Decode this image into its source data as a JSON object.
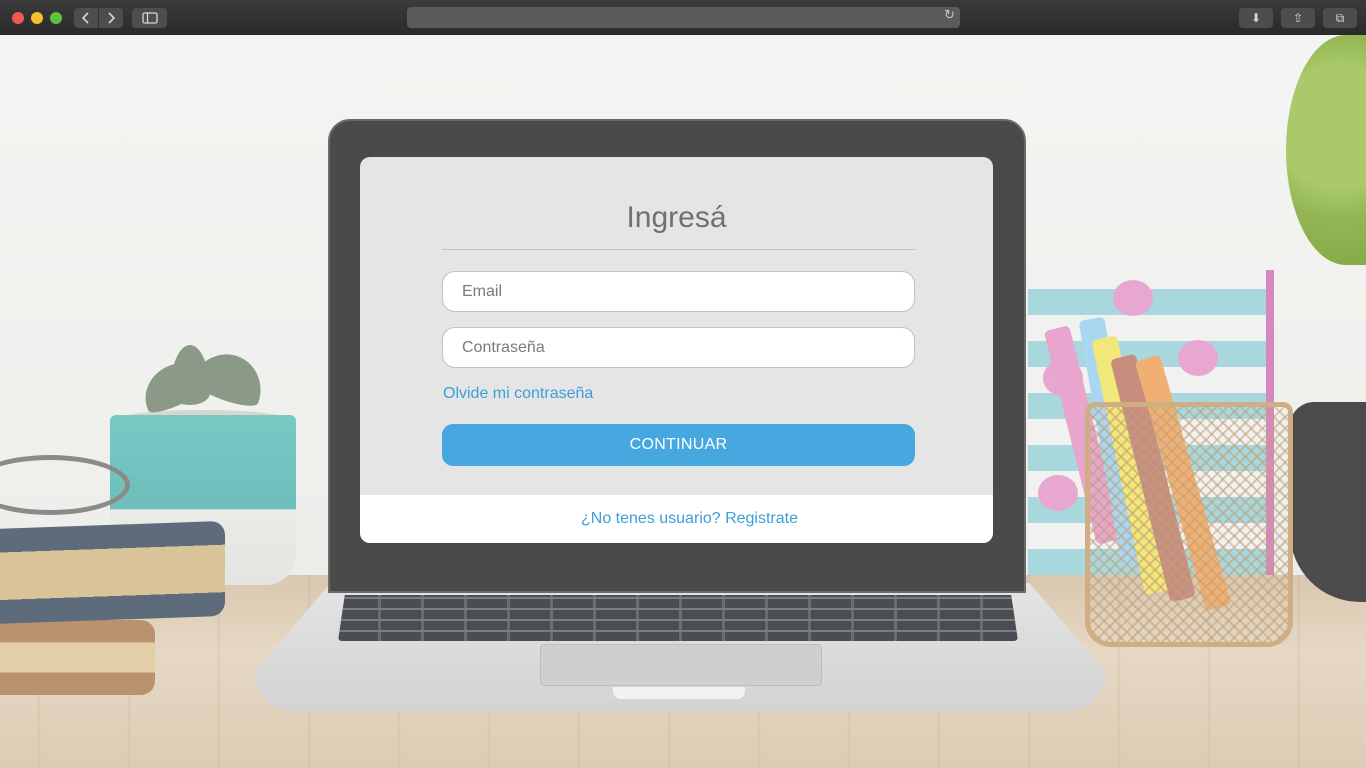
{
  "browser": {
    "traffic_lights": {
      "close": "#ee5a52",
      "minimize": "#f5bf2f",
      "zoom": "#5fc23c"
    },
    "back_icon": "chevron-left-icon",
    "forward_icon": "chevron-right-icon",
    "sidebar_icon": "sidebar-icon",
    "reload_glyph": "↻",
    "download_glyph": "⬇",
    "share_glyph": "⇧",
    "tabs_glyph": "⧉"
  },
  "login": {
    "title": "Ingresá",
    "email_placeholder": "Email",
    "email_value": "",
    "password_placeholder": "Contraseña",
    "password_value": "",
    "forgot_label": "Olvide mi contraseña",
    "continue_label": "CONTINUAR",
    "register_label": "¿No tenes usuario? Registrate",
    "accent_color": "#47a8e0",
    "link_color": "#3c9fd8"
  }
}
